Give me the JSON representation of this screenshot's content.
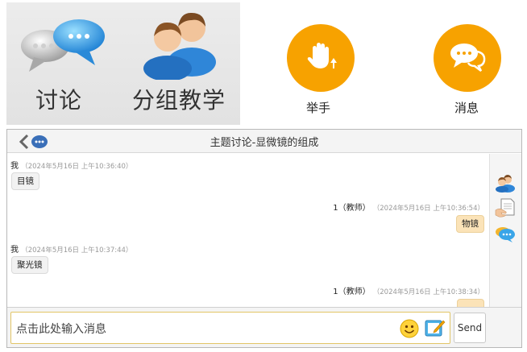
{
  "toolbar_left": {
    "discuss_label": "讨论",
    "group_label": "分组教学"
  },
  "toolbar_right": {
    "raise_hand_label": "举手",
    "message_label": "消息"
  },
  "chat": {
    "title": "主题讨论-显微镜的组成",
    "messages": [
      {
        "side": "left",
        "sender": "我",
        "time": "（2024年5月16日 上午10:36:40）",
        "text": "目镜"
      },
      {
        "side": "right",
        "sender": "1（教师）",
        "time": "（2024年5月16日 上午10:36:54）",
        "text": "物镜"
      },
      {
        "side": "left",
        "sender": "我",
        "time": "（2024年5月16日 上午10:37:44）",
        "text": "聚光镜"
      },
      {
        "side": "right",
        "sender": "1（教师）",
        "time": "（2024年5月16日 上午10:38:34）",
        "text": ""
      }
    ],
    "input_placeholder": "点击此处输入消息",
    "send_label": "Send"
  },
  "colors": {
    "accent_orange": "#f7a200",
    "bubble_self": "#f2f2f2",
    "bubble_teacher": "#fbe3b8",
    "input_border": "#e2c566"
  },
  "icons": {
    "discuss": "speech-bubbles-icon",
    "group": "two-people-icon",
    "raise_hand": "raise-hand-icon",
    "message": "chat-bubbles-icon",
    "back": "back-arrow-icon",
    "rail": [
      "people-icon",
      "document-hand-icon",
      "chat-bubbles-icon"
    ],
    "emoji": "smiley-icon",
    "pad": "notepad-icon"
  }
}
